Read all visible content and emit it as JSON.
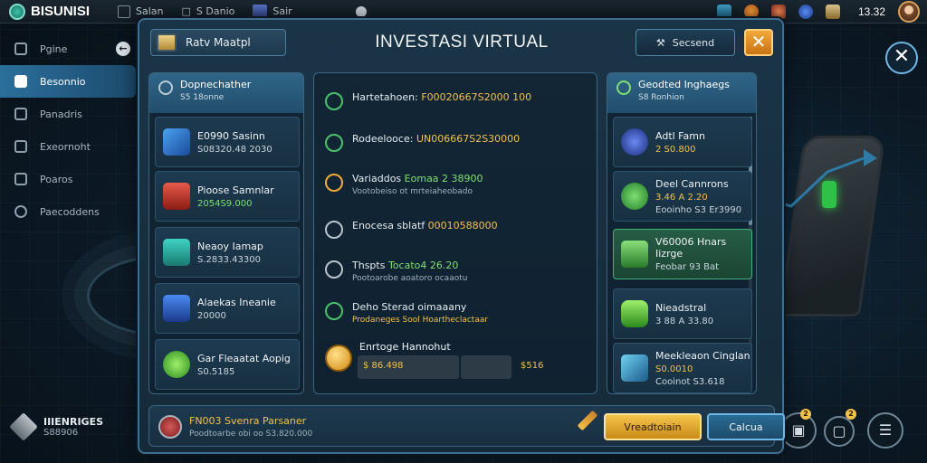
{
  "topbar": {
    "app_name": "BISUNISI",
    "nav": [
      {
        "label": "Salan",
        "icon": "square-icon"
      },
      {
        "label": "S Danio",
        "icon": "book-icon"
      },
      {
        "label": "Sair",
        "icon": "image-icon"
      }
    ],
    "clock": "13.32"
  },
  "sidebar": {
    "items": [
      {
        "label": "Pgine",
        "icon": "gauge-icon"
      },
      {
        "label": "Besonnio",
        "icon": "home-icon",
        "active": true
      },
      {
        "label": "Panadris",
        "icon": "check-icon"
      },
      {
        "label": "Exeornoht",
        "icon": "box-icon"
      },
      {
        "label": "Poaros",
        "icon": "document-icon"
      },
      {
        "label": "Paecoddens",
        "icon": "help-icon"
      }
    ],
    "bottom": {
      "title": "IIIENRIGES",
      "sub": "S88906"
    }
  },
  "window": {
    "tab_label": "Ratv Maatpl",
    "title": "INVESTASI VIRTUAL",
    "settings_label": "Secsend"
  },
  "left_panel": {
    "title": "Dopnechather",
    "subtitle": "S5 18onne",
    "cards": [
      {
        "title": "E0990 Sasinn",
        "value": "S08320.48 2030"
      },
      {
        "title": "Pioose Samnlar",
        "value": "2054S9.000"
      },
      {
        "title": "Neaoy Iamap",
        "value": "S.2833.43300"
      },
      {
        "title": "Alaekas Ineanie",
        "value": "20000"
      },
      {
        "title": "Gar Fleaatat Aopig",
        "value": "S0.5185"
      }
    ]
  },
  "middle_panel": {
    "rows": [
      {
        "label": "Hartetahoen:",
        "value": "F00020667S2000 100",
        "sub": ""
      },
      {
        "label": "Rodeelooce:",
        "value": "UN006667S2S30000",
        "sub": ""
      },
      {
        "label": "Variaddos",
        "value": "Eomaa 2 38900",
        "sub": "Vootobeiso ot mrteiaheobado"
      },
      {
        "label": "Enocesa sblatf",
        "value": "00010588000",
        "sub": ""
      },
      {
        "label": "Thspts",
        "value": "Tocato4 26.20",
        "sub": "Pootoarobe aoatoro ocaaotu"
      },
      {
        "label": "Deho Sterad oimaaany",
        "value": "",
        "sub": "Prodaneges Sool Hoartheclactaar"
      }
    ],
    "bottom": {
      "title": "Enrtoge Hannohut",
      "value": "$ 86.498",
      "value2": "$516"
    }
  },
  "right_panel": {
    "title": "Geodted Inghaegs",
    "subtitle": "S8 Ronhion",
    "cards": [
      {
        "title": "Adtl Famn",
        "value": "2 S0.800"
      },
      {
        "title": "Deel Cannrons",
        "value": "3.46 A 2.20",
        "sub": "Eooinho S3 Er3990"
      },
      {
        "title": "V60006 Hnars Iizrge",
        "value": "Feobar 93 Bat"
      },
      {
        "title": "Nieadstral",
        "value": "3 88 A 33.80"
      },
      {
        "title": "Meekleaon Cinglan",
        "value": "S0.0010",
        "sub": "Cooinot S3.618"
      }
    ]
  },
  "footer": {
    "title": "FN003 Svenra Parsaner",
    "subtitle": "Poodtoarbe obi oo S3.820.000",
    "primary_label": "Vreadtoiain",
    "secondary_label": "Calcua"
  },
  "colors": {
    "accent": "#2b6f9c",
    "gold": "#f2c14a",
    "green": "#7ee070",
    "close": "#f2a93b"
  }
}
